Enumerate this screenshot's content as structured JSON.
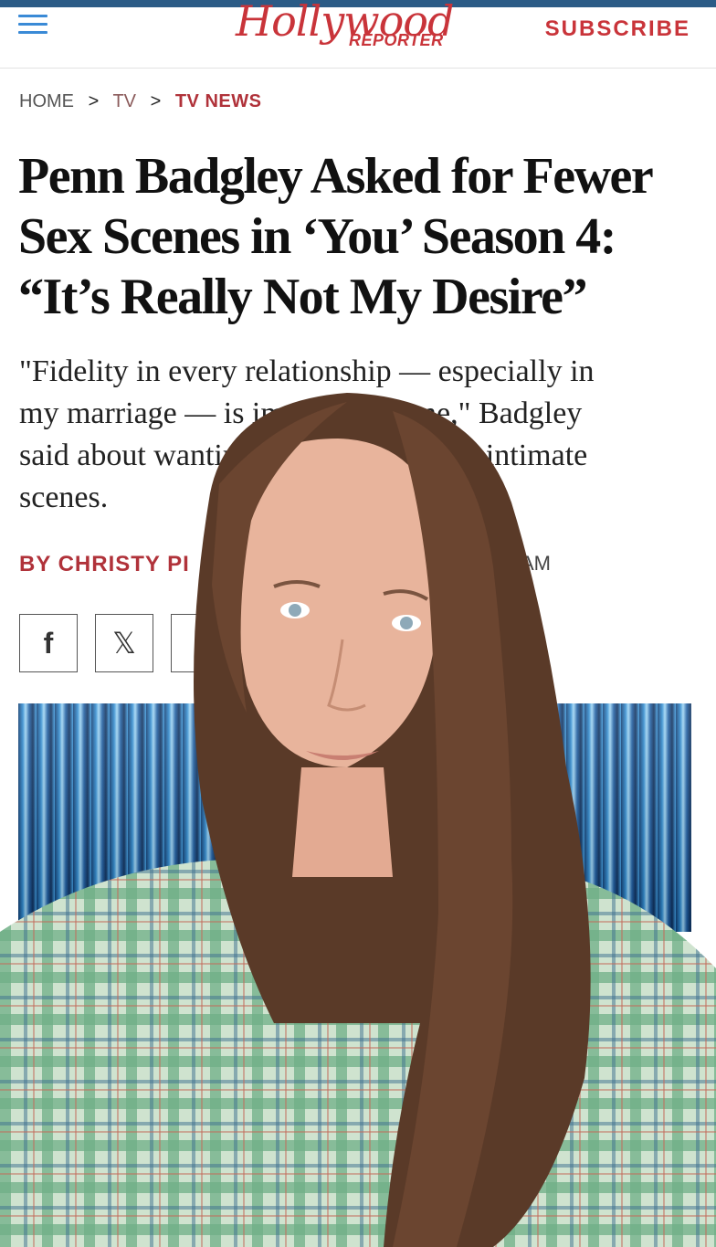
{
  "header": {
    "logo_script": "Hollywood",
    "logo_sub": "REPORTER",
    "subscribe": "SUBSCRIBE"
  },
  "breadcrumb": {
    "home": "HOME",
    "sep": ">",
    "tv": "TV",
    "current": "TV NEWS"
  },
  "article": {
    "headline_lines": [
      "Penn Badgley Asked for Fewer",
      "Sex Scenes in ‘You’ Season 4:",
      "“It’s Really Not My Desire”"
    ],
    "dek_lines": [
      "\"Fidelity in every relationship — especially in",
      "my marriage — is important to me,\" Badgley",
      "said about wanting to step back from intimate",
      "scenes."
    ],
    "byline": "BY CHRISTY PI",
    "time_partial": "AM"
  },
  "share": {
    "facebook": "f",
    "x": "𝕏"
  },
  "colors": {
    "brand_red": "#c9343a",
    "link_blue": "#3a8ad6",
    "top_strip": "#2b5b86"
  },
  "icons": {
    "menu": "hamburger-menu-icon",
    "facebook": "facebook-icon",
    "x": "x-twitter-icon"
  }
}
